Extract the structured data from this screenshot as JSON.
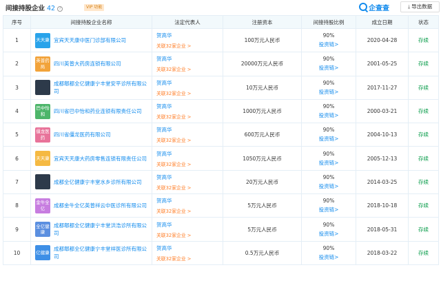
{
  "header": {
    "title": "间接持股企业",
    "count": "42",
    "vip_label": "VIP 功能",
    "logo_text": "企查查",
    "export_label": "导出数据"
  },
  "table": {
    "columns": [
      "序号",
      "间接持股企业名称",
      "法定代表人",
      "注册资本",
      "间接持股比例",
      "成立日期",
      "状态"
    ],
    "rows": [
      {
        "idx": "1",
        "logo_text": "天天康",
        "logo_color": "#29a3ea",
        "name": "宜宾天天康中医门诊部有限公司",
        "rep": "贺高华",
        "rep_link": "关联32家企业 >",
        "capital": "100万元人民币",
        "ratio": "90%",
        "chain": "投资链>",
        "date": "2020-04-28",
        "status": "存续"
      },
      {
        "idx": "2",
        "logo_text": "英普药局",
        "logo_color": "#f2a33a",
        "name": "四川英普大药房连锁有限公司",
        "rep": "贺高华",
        "rep_link": "关联32家企业 >",
        "capital": "20000万元人民币",
        "ratio": "90%",
        "chain": "投资链>",
        "date": "2001-05-25",
        "status": "存续"
      },
      {
        "idx": "3",
        "logo_text": "",
        "logo_color": "#2d3a4a",
        "name": "成都郫都全亿健康宁丰堂安平诊所有限公司",
        "rep": "贺高华",
        "rep_link": "关联32家企业 >",
        "capital": "10万元人民币",
        "ratio": "90%",
        "chain": "投资链>",
        "date": "2017-11-27",
        "status": "存续"
      },
      {
        "idx": "4",
        "logo_text": "巴中怡和",
        "logo_color": "#4db56a",
        "name": "四川省巴中怡和药业连锁有限责任公司",
        "rep": "贺高华",
        "rep_link": "关联32家企业 >",
        "capital": "1000万元人民币",
        "ratio": "90%",
        "chain": "投资链>",
        "date": "2000-03-21",
        "status": "存续"
      },
      {
        "idx": "5",
        "logo_text": "僵龙医药",
        "logo_color": "#e8739a",
        "name": "四川省僵龙医药有限公司",
        "rep": "贺高华",
        "rep_link": "关联32家企业 >",
        "capital": "600万元人民币",
        "ratio": "90%",
        "chain": "投资链>",
        "date": "2004-10-13",
        "status": "存续"
      },
      {
        "idx": "6",
        "logo_text": "天天康",
        "logo_color": "#f5b942",
        "name": "宜宾天天康大药房零售连锁有限责任公司",
        "rep": "贺高华",
        "rep_link": "关联32家企业 >",
        "capital": "1050万元人民币",
        "ratio": "90%",
        "chain": "投资链>",
        "date": "2005-12-13",
        "status": "存续"
      },
      {
        "idx": "7",
        "logo_text": "",
        "logo_color": "#2d3a4a",
        "name": "成都全亿健康宁丰堂水乡诊所有限公司",
        "rep": "贺高华",
        "rep_link": "关联32家企业 >",
        "capital": "20万元人民币",
        "ratio": "90%",
        "chain": "投资链>",
        "date": "2014-03-25",
        "status": "存续"
      },
      {
        "idx": "8",
        "logo_text": "金牛全亿",
        "logo_color": "#c77de0",
        "name": "成都金牛全亿英普祥云中医诊所有限公司",
        "rep": "贺高华",
        "rep_link": "关联32家企业 >",
        "capital": "5万元人民币",
        "ratio": "90%",
        "chain": "投资链>",
        "date": "2018-10-18",
        "status": "存续"
      },
      {
        "idx": "9",
        "logo_text": "全亿健康",
        "logo_color": "#5b8fe0",
        "name": "成都郫都全亿健康宁丰堂洪浩诊所有限公司",
        "rep": "贺高华",
        "rep_link": "关联32家企业 >",
        "capital": "5万元人民币",
        "ratio": "90%",
        "chain": "投资链>",
        "date": "2018-05-31",
        "status": "存续"
      },
      {
        "idx": "10",
        "logo_text": "亿健康",
        "logo_color": "#3e8fe6",
        "name": "成都郫都全亿健康宁丰堂祥医诊所有限公司",
        "rep": "贺高华",
        "rep_link": "关联32家企业 >",
        "capital": "0.5万元人民币",
        "ratio": "90%",
        "chain": "投资链>",
        "date": "2018-03-22",
        "status": "存续"
      }
    ]
  }
}
